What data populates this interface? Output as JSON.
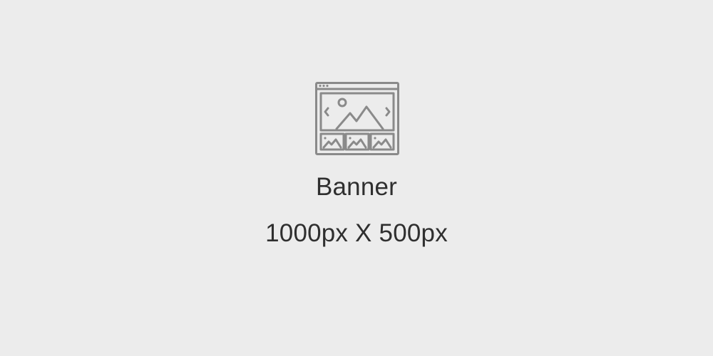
{
  "placeholder": {
    "icon": "image-gallery-icon",
    "title": "Banner",
    "dimensions": "1000px X 500px"
  },
  "colors": {
    "background": "#ececec",
    "icon": "#8a8a8a",
    "text": "#2f2f2f"
  }
}
